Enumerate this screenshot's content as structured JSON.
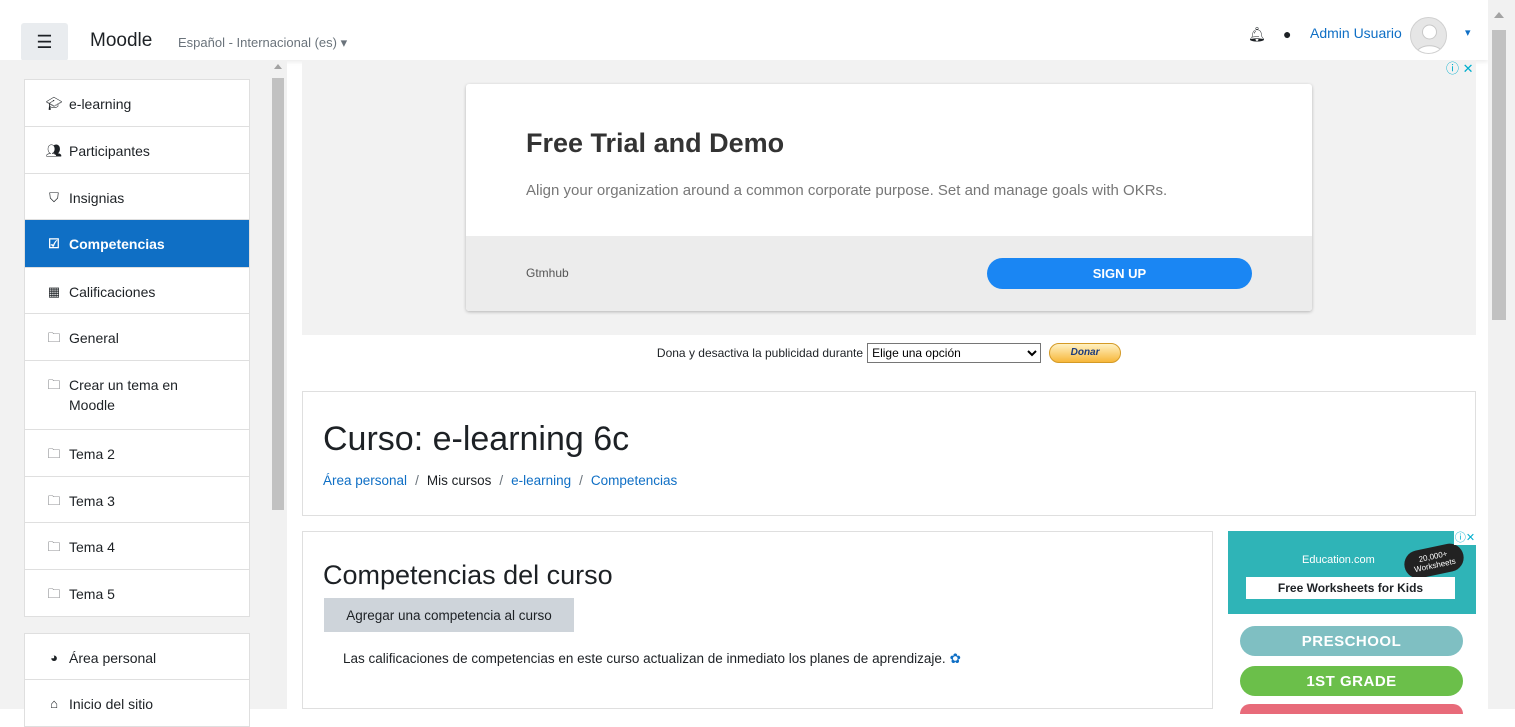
{
  "navbar": {
    "menu_icon": "hamburger-icon",
    "brand": "Moodle",
    "language": "Español - Internacional (es) ▾",
    "notifications_icon": "bell-icon",
    "messages_icon": "chat-icon",
    "user_name": "Admin Usuario",
    "user_menu_caret": "▾"
  },
  "drawer": {
    "course_items": [
      {
        "label": "e-learning",
        "icon": "graduation-cap-icon"
      },
      {
        "label": "Participantes",
        "icon": "users-icon"
      },
      {
        "label": "Insignias",
        "icon": "shield-icon"
      },
      {
        "label": "Competencias",
        "icon": "check-square-icon",
        "active": true
      },
      {
        "label": "Calificaciones",
        "icon": "table-icon"
      },
      {
        "label": "General",
        "icon": "folder-icon"
      },
      {
        "label": "Crear un tema en Moodle",
        "icon": "folder-icon"
      },
      {
        "label": "Tema 2",
        "icon": "folder-icon"
      },
      {
        "label": "Tema 3",
        "icon": "folder-icon"
      },
      {
        "label": "Tema 4",
        "icon": "folder-icon"
      },
      {
        "label": "Tema 5",
        "icon": "folder-icon"
      }
    ],
    "site_items": [
      {
        "label": "Área personal",
        "icon": "dashboard-icon"
      },
      {
        "label": "Inicio del sitio",
        "icon": "home-icon"
      }
    ]
  },
  "ad_banner": {
    "info_close": "ⓘ ✕",
    "title": "Free Trial and Demo",
    "text": "Align your organization around a common corporate purpose. Set and manage goals with OKRs.",
    "advertiser": "Gtmhub",
    "cta": "SIGN UP"
  },
  "donate": {
    "text": "Dona y desactiva la publicidad durante",
    "select_value": "Elige una opción",
    "button": "Donar"
  },
  "page_header": {
    "title": "Curso: e-learning 6c",
    "breadcrumb": [
      "Área personal",
      "Mis cursos",
      "e-learning",
      "Competencias"
    ]
  },
  "content": {
    "heading": "Competencias del curso",
    "add_button": "Agregar una competencia al curso",
    "info_text": "Las calificaciones de competencias en este curso actualizan de inmediato los planes de aprendizaje."
  },
  "side_ad": {
    "brand": "Education.com",
    "badge": "20,000+ Worksheets",
    "tagline": "Free Worksheets for Kids",
    "close": "ⓘ✕",
    "grades": [
      "PRESCHOOL",
      "1ST GRADE"
    ]
  },
  "colors": {
    "primary": "#0f6fc5",
    "ad_cta": "#1a86f3",
    "side_ad_teal": "#2fb4b7"
  }
}
